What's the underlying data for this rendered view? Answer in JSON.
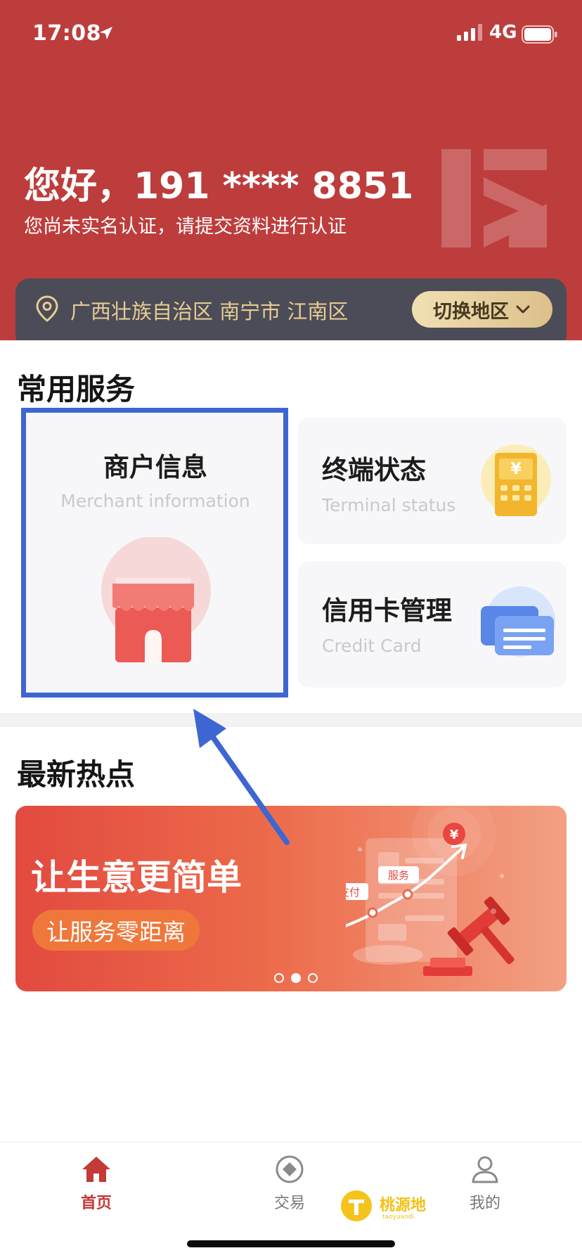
{
  "status_bar": {
    "time": "17:08",
    "network": "4G"
  },
  "header": {
    "greeting": "您好，191 **** 8851",
    "verify_hint": "您尚未实名认证，请提交资料进行认证",
    "location": "广西壮族自治区 南宁市 江南区",
    "switch_region_label": "切换地区"
  },
  "services": {
    "title": "常用服务",
    "items": [
      {
        "title": "商户信息",
        "subtitle": "Merchant information",
        "icon": "shop-icon"
      },
      {
        "title": "终端状态",
        "subtitle": "Terminal status",
        "icon": "pos-terminal-icon"
      },
      {
        "title": "信用卡管理",
        "subtitle": "Credit Card",
        "icon": "credit-card-icon"
      }
    ]
  },
  "hot": {
    "title": "最新热点",
    "banner": {
      "title": "让生意更简单",
      "pill": "让服务零距离",
      "tag_pay": "支付",
      "tag_service": "服务",
      "currency": "¥",
      "dots_total": 3,
      "dots_active": 2
    }
  },
  "tabbar": {
    "items": [
      {
        "label": "首页",
        "icon": "home-icon",
        "active": true
      },
      {
        "label": "交易",
        "icon": "trade-icon",
        "active": false
      },
      {
        "label": "我的",
        "icon": "user-icon",
        "active": false
      }
    ]
  },
  "watermark": {
    "text": "桃源地",
    "small": "taoyuandi"
  },
  "colors": {
    "brand_red": "#bd3d3c",
    "location_bar": "#4b4c57",
    "gold": "#e7cc93",
    "highlight_blue": "#3d66d3"
  }
}
